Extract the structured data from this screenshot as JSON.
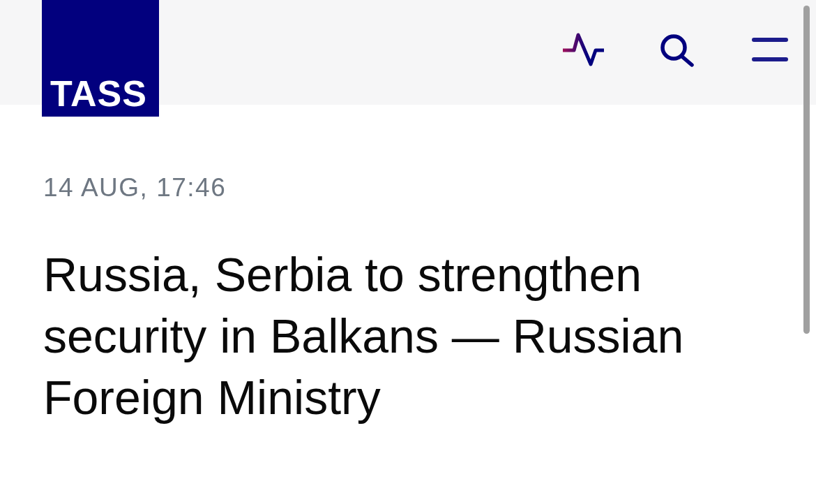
{
  "header": {
    "logo": "TASS"
  },
  "article": {
    "date": "14 AUG, 17:46",
    "headline": "Russia, Serbia to strengthen security in Balkans — Russian Foreign Ministry"
  }
}
